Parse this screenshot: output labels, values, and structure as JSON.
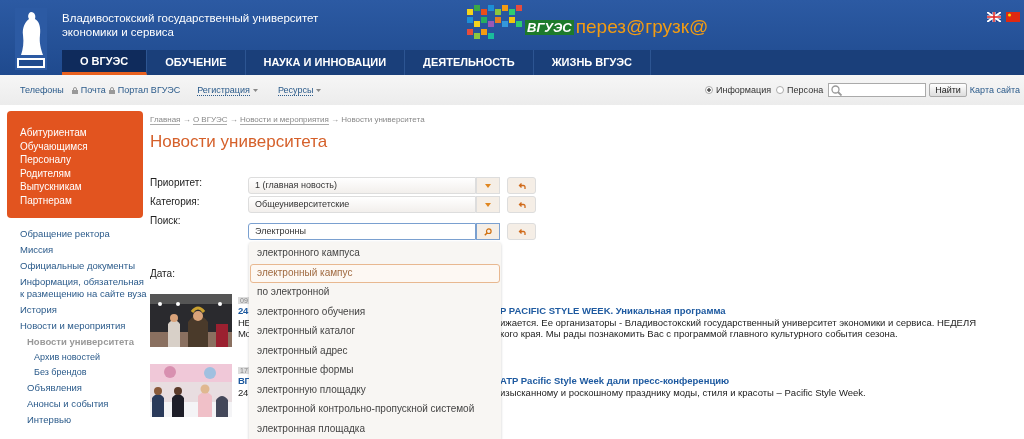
{
  "header": {
    "university_name": "Владивостокский государственный университет экономики и сервиса",
    "logo_caption": "ВГУЭС",
    "slogan": "перез@грузк@"
  },
  "nav": [
    {
      "label": "О ВГУЭС",
      "selected": true
    },
    {
      "label": "ОБУЧЕНИЕ",
      "selected": false
    },
    {
      "label": "НАУКА И ИННОВАЦИИ",
      "selected": false
    },
    {
      "label": "ДЕЯТЕЛЬНОСТЬ",
      "selected": false
    },
    {
      "label": "ЖИЗНЬ ВГУЭС",
      "selected": false
    }
  ],
  "toolbar": {
    "links": [
      {
        "label": "Телефоны",
        "kind": "plain"
      },
      {
        "label": "Почта",
        "kind": "locked"
      },
      {
        "label": "Портал ВГУЭС",
        "kind": "locked"
      },
      {
        "label": "Регистрация",
        "kind": "menu"
      },
      {
        "label": "Ресурсы",
        "kind": "menu"
      }
    ],
    "scope_options": [
      {
        "label": "Информация",
        "selected": true
      },
      {
        "label": "Персона",
        "selected": false
      }
    ],
    "search_button": "Найти",
    "sitemap": "Карта сайта"
  },
  "audiences": [
    "Абитуриентам",
    "Обучающимся",
    "Персоналу",
    "Родителям",
    "Выпускникам",
    "Партнерам"
  ],
  "sidebar": [
    {
      "label": "Обращение ректора",
      "selected": false
    },
    {
      "label": "Миссия",
      "selected": false
    },
    {
      "label": "Официальные документы",
      "selected": false
    },
    {
      "label": "Информация, обязательная к размещению на сайте вуза",
      "selected": false
    },
    {
      "label": "История",
      "selected": false
    },
    {
      "label": "Новости и мероприятия",
      "selected": false,
      "children": [
        {
          "label": "Новости университета",
          "selected": true,
          "children": [
            {
              "label": "Архив новостей",
              "selected": false
            },
            {
              "label": "Без брендов",
              "selected": false
            }
          ]
        },
        {
          "label": "Объявления",
          "selected": false
        },
        {
          "label": "Анонсы и события",
          "selected": false
        },
        {
          "label": "Интервью",
          "selected": false
        }
      ]
    }
  ],
  "breadcrumb": [
    {
      "label": "Главная",
      "kind": "link"
    },
    {
      "label": "→",
      "kind": "separator"
    },
    {
      "label": "О ВГУЭС",
      "kind": "link"
    },
    {
      "label": "→",
      "kind": "separator"
    },
    {
      "label": "Новости и мероприятия",
      "kind": "link"
    },
    {
      "label": "→",
      "kind": "separator"
    },
    {
      "label": "Новости университета",
      "kind": "current"
    }
  ],
  "title": "Новости университета",
  "filters": [
    {
      "label": "Приоритет:",
      "kind": "select",
      "value": "1 (главная новость)"
    },
    {
      "label": "Категория:",
      "kind": "select",
      "value": "Общеуниверситетские"
    },
    {
      "label": "Поиск:",
      "kind": "search",
      "value": "Электронны"
    },
    {
      "label": "Дата:",
      "kind": "date"
    }
  ],
  "suggestions": [
    {
      "label": "электронного кампуса",
      "selected": false
    },
    {
      "label": "электронный кампус",
      "selected": true
    },
    {
      "label": "по электронной",
      "selected": false
    },
    {
      "label": "электронного обучения",
      "selected": false
    },
    {
      "label": "электронный каталог",
      "selected": false
    },
    {
      "label": "электронный адрес",
      "selected": false
    },
    {
      "label": "электронные формы",
      "selected": false
    },
    {
      "label": "электронную площадку",
      "selected": false
    },
    {
      "label": "электронной контрольно-пропускной системой",
      "selected": false
    },
    {
      "label": "электронная площадка",
      "selected": false
    }
  ],
  "news": [
    {
      "date": "09",
      "title": [
        "24",
        "P PACIFIC STYLE WEEK. Уникальная программа"
      ],
      "lines": [
        [
          "НЕ",
          "ижается. Ее организаторы - Владивостокский государственный университет экономики и сервиса. НЕДЕЛЯ"
        ],
        [
          "Мо",
          "кого края. Мы рады познакомить Вас с программой главного культурного события сезона."
        ]
      ]
    },
    {
      "date": "17",
      "title": [
        "ВГ",
        "ATP Pacific Style Week дали пресс-конференцию"
      ],
      "lines": [
        [
          "24",
          "изысканному и роскошному празднику моды, стиля и красоты – Pacific Style Week."
        ]
      ]
    }
  ]
}
